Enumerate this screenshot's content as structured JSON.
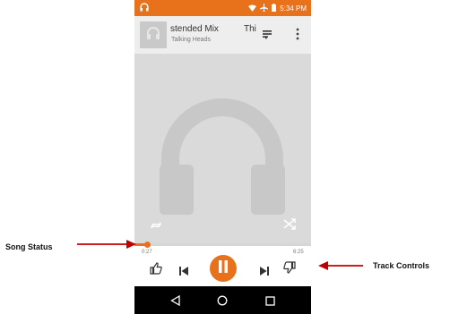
{
  "status_bar": {
    "time": "5:34 PM",
    "left_icon": "headphones-icon",
    "icons": [
      "wifi-icon",
      "airplane-icon",
      "battery-icon"
    ],
    "color": "#e8711c"
  },
  "now_playing": {
    "title": "stended Mix",
    "artist": "Talking Heads",
    "next_title": "Thi",
    "queue_icon": "queue-icon",
    "more_icon": "more-vert-icon"
  },
  "player": {
    "album_art_icon": "headphones-icon",
    "repeat_icon": "repeat-icon",
    "shuffle_icon": "shuffle-icon",
    "elapsed": "0:27",
    "total": "6:25",
    "progress_fraction": 0.07,
    "accent": "#e8711c"
  },
  "controls": {
    "thumb_up": "thumb-up-icon",
    "previous": "skip-previous-icon",
    "play_pause": "pause-icon",
    "next": "skip-next-icon",
    "thumb_down": "thumb-down-icon"
  },
  "nav_bar": {
    "back": "back-icon",
    "home": "home-icon",
    "recents": "recents-icon"
  },
  "callouts": {
    "song_status": "Song Status",
    "track_controls": "Track Controls",
    "arrow_color": "#c00000"
  }
}
